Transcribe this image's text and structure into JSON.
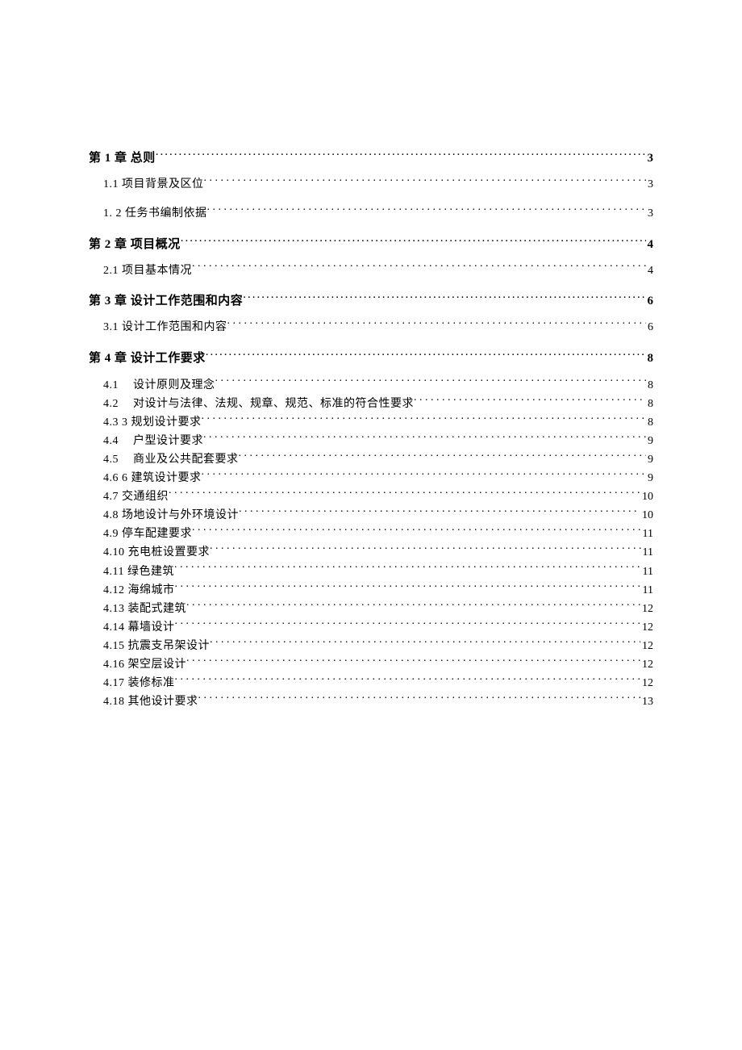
{
  "toc": [
    {
      "level": 1,
      "title": "第 1 章 总则",
      "page": "3"
    },
    {
      "level": 2,
      "title": "1.1 项目背景及区位",
      "page": "3"
    },
    {
      "level": 2,
      "title": "1. 2 任务书编制依据",
      "page": "3"
    },
    {
      "level": 1,
      "title": "第 2 章 项目概况",
      "page": "4"
    },
    {
      "level": 2,
      "title": "2.1 项目基本情况",
      "page": "4"
    },
    {
      "level": 1,
      "title": "第 3 章 设计工作范围和内容",
      "page": "6"
    },
    {
      "level": 2,
      "title": "3.1 设计工作范围和内容",
      "page": "6"
    },
    {
      "level": 1,
      "title": "第 4 章 设计工作要求",
      "page": "8"
    },
    {
      "level": 3,
      "num": "4.1",
      "title": "设计原则及理念",
      "page": "8",
      "gap": true
    },
    {
      "level": 3,
      "num": "4.2",
      "title": "对设计与法律、法规、规章、规范、标准的符合性要求",
      "page": "8",
      "gap": true
    },
    {
      "level": 3,
      "num": "4.3",
      "title": "3 规划设计要求",
      "page": "8"
    },
    {
      "level": 3,
      "num": "4.4",
      "title": "户型设计要求",
      "page": "9",
      "gap": true
    },
    {
      "level": 3,
      "num": "4.5",
      "title": "商业及公共配套要求",
      "page": "9",
      "gap": true
    },
    {
      "level": 3,
      "num": "4.6",
      "title": "6 建筑设计要求",
      "page": "9"
    },
    {
      "level": 3,
      "num": "4.7",
      "title": "交通组织",
      "page": "10"
    },
    {
      "level": 3,
      "num": "4.8",
      "title": "场地设计与外环境设计",
      "page": "10"
    },
    {
      "level": 3,
      "num": "4.9",
      "title": "停车配建要求",
      "page": "11"
    },
    {
      "level": 3,
      "num": "4.10",
      "title": "充电桩设置要求",
      "page": "11"
    },
    {
      "level": 3,
      "num": "4.11",
      "title": "绿色建筑",
      "page": "11"
    },
    {
      "level": 3,
      "num": "4.12",
      "title": "海绵城市",
      "page": "11"
    },
    {
      "level": 3,
      "num": "4.13",
      "title": "装配式建筑",
      "page": "12"
    },
    {
      "level": 3,
      "num": "4.14",
      "title": "幕墙设计",
      "page": "12"
    },
    {
      "level": 3,
      "num": "4.15",
      "title": "抗震支吊架设计",
      "page": "12"
    },
    {
      "level": 3,
      "num": "4.16",
      "title": "架空层设计",
      "page": "12"
    },
    {
      "level": 3,
      "num": "4.17",
      "title": "装修标准",
      "page": "12"
    },
    {
      "level": 3,
      "num": "4.18",
      "title": "其他设计要求",
      "page": "13"
    }
  ]
}
